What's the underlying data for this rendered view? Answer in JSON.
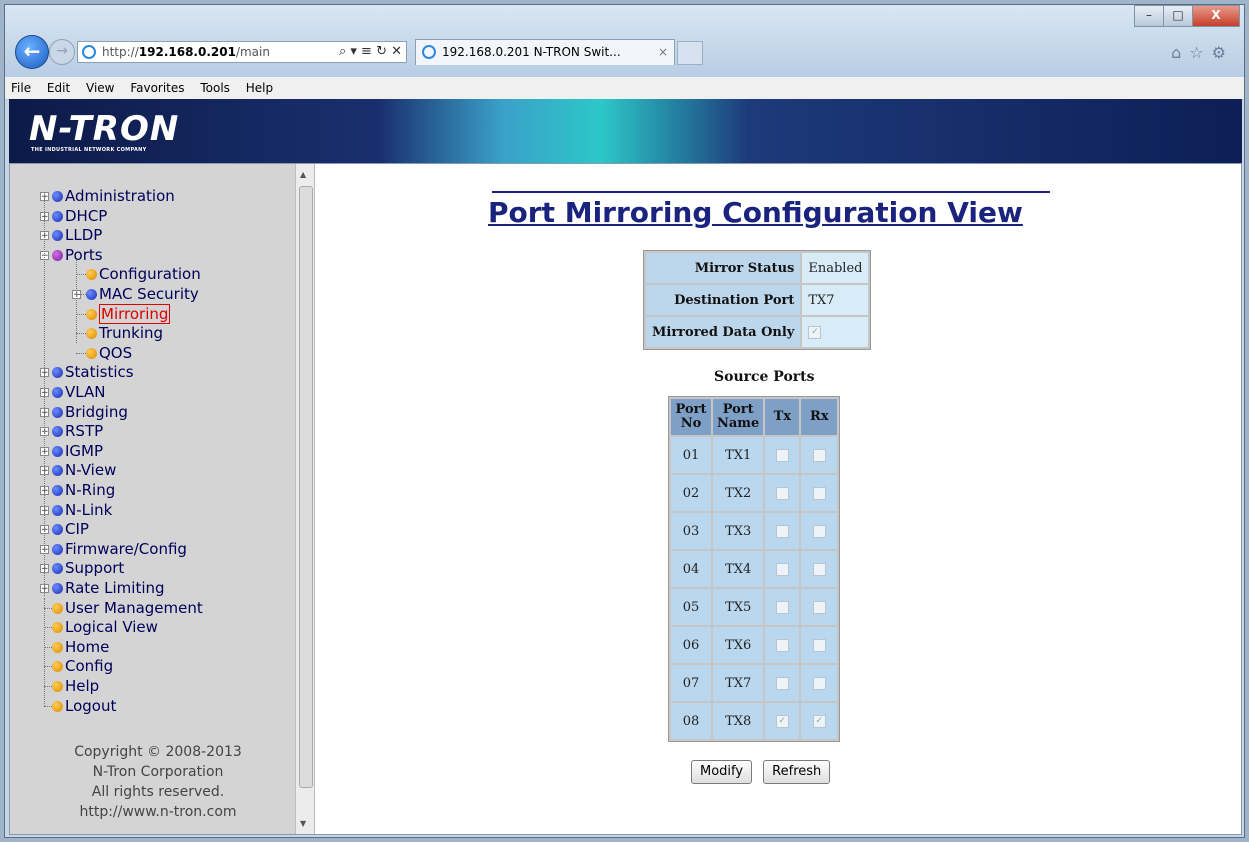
{
  "browser": {
    "url_prefix": "http://",
    "url_host": "192.168.0.201",
    "url_path": "/main",
    "url_tools": "⌕ ▾ ≡ ↻ ✕",
    "tab_title": "192.168.0.201 N-TRON Swit...",
    "tab_close": "×",
    "menu": [
      "File",
      "Edit",
      "View",
      "Favorites",
      "Tools",
      "Help"
    ],
    "window_controls": [
      "–",
      "□",
      "X"
    ],
    "right_icons": "⌂☆⚙"
  },
  "banner": {
    "logo": "N-TRON",
    "logo_sub": "THE INDUSTRIAL NETWORK COMPANY"
  },
  "sidebar": {
    "items": [
      {
        "label": "Administration",
        "expandable": true
      },
      {
        "label": "DHCP",
        "expandable": true
      },
      {
        "label": "LLDP",
        "expandable": true
      },
      {
        "label": "Ports",
        "expandable": true
      },
      {
        "label": "Configuration",
        "expandable": false
      },
      {
        "label": "MAC Security",
        "expandable": true
      },
      {
        "label": "Mirroring",
        "expandable": false,
        "active": true
      },
      {
        "label": "Trunking",
        "expandable": false
      },
      {
        "label": "QOS",
        "expandable": false
      },
      {
        "label": "Statistics",
        "expandable": true
      },
      {
        "label": "VLAN",
        "expandable": true
      },
      {
        "label": "Bridging",
        "expandable": true
      },
      {
        "label": "RSTP",
        "expandable": true
      },
      {
        "label": "IGMP",
        "expandable": true
      },
      {
        "label": "N-View",
        "expandable": true
      },
      {
        "label": "N-Ring",
        "expandable": true
      },
      {
        "label": "N-Link",
        "expandable": true
      },
      {
        "label": "CIP",
        "expandable": true
      },
      {
        "label": "Firmware/Config",
        "expandable": true
      },
      {
        "label": "Support",
        "expandable": true
      },
      {
        "label": "Rate Limiting",
        "expandable": true
      },
      {
        "label": "User Management",
        "expandable": false
      },
      {
        "label": "Logical View",
        "expandable": false
      },
      {
        "label": "Home",
        "expandable": false
      },
      {
        "label": "Config",
        "expandable": false
      },
      {
        "label": "Help",
        "expandable": false
      },
      {
        "label": "Logout",
        "expandable": false
      }
    ],
    "copyright_lines": [
      "Copyright © 2008-2013",
      "N-Tron Corporation",
      "All rights reserved.",
      "http://www.n-tron.com"
    ]
  },
  "main": {
    "title": "Port Mirroring Configuration View",
    "status": {
      "mirror_status_label": "Mirror Status",
      "mirror_status_value": "Enabled",
      "destination_port_label": "Destination Port",
      "destination_port_value": "TX7",
      "mirrored_data_only_label": "Mirrored Data Only",
      "mirrored_data_only_checked": true
    },
    "source_ports_title": "Source Ports",
    "columns": [
      "Port No",
      "Port Name",
      "Tx",
      "Rx"
    ],
    "ports": [
      {
        "no": "01",
        "name": "TX1",
        "tx": false,
        "rx": false
      },
      {
        "no": "02",
        "name": "TX2",
        "tx": false,
        "rx": false
      },
      {
        "no": "03",
        "name": "TX3",
        "tx": false,
        "rx": false
      },
      {
        "no": "04",
        "name": "TX4",
        "tx": false,
        "rx": false
      },
      {
        "no": "05",
        "name": "TX5",
        "tx": false,
        "rx": false
      },
      {
        "no": "06",
        "name": "TX6",
        "tx": false,
        "rx": false
      },
      {
        "no": "07",
        "name": "TX7",
        "tx": false,
        "rx": false
      },
      {
        "no": "08",
        "name": "TX8",
        "tx": true,
        "rx": true
      }
    ],
    "buttons": {
      "modify": "Modify",
      "refresh": "Refresh"
    }
  },
  "colors": {
    "title": "#1a237e",
    "header_cell": "#7e9fc6",
    "data_cell": "#b9d7ee",
    "status_label_cell": "#bcd6ec",
    "active_link": "#d00000"
  }
}
